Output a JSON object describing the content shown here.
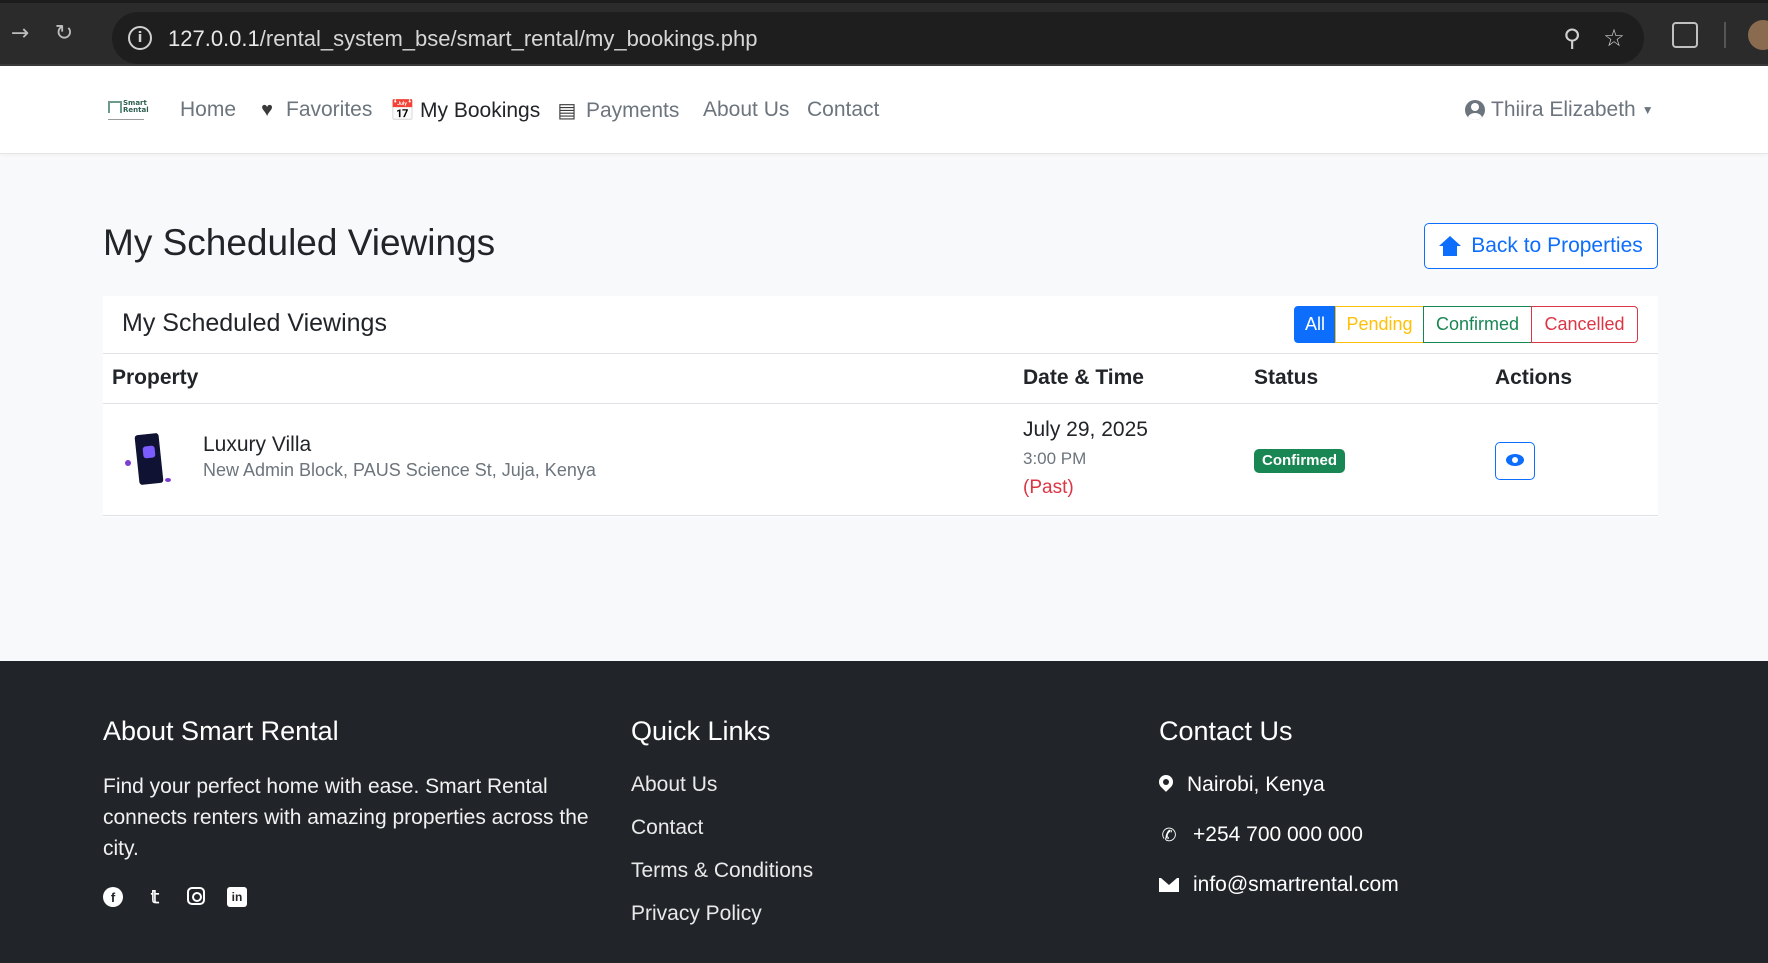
{
  "browser": {
    "url_host": "127.0.0.1",
    "url_path": "/rental_system_bse/smart_rental/my_bookings.php"
  },
  "navbar": {
    "logo_text": "Smart Rental",
    "links": [
      {
        "label": "Home",
        "icon": ""
      },
      {
        "label": "Favorites",
        "icon": "heart-icon"
      },
      {
        "label": "My Bookings",
        "icon": "calendar-icon",
        "active": true
      },
      {
        "label": "Payments",
        "icon": "credit-card-icon"
      },
      {
        "label": "About Us",
        "icon": ""
      },
      {
        "label": "Contact",
        "icon": ""
      }
    ],
    "user_name": "Thiira Elizabeth"
  },
  "page": {
    "title": "My Scheduled Viewings",
    "back_button": "Back to Properties"
  },
  "card": {
    "title": "My Scheduled Viewings",
    "filters": [
      "All",
      "Pending",
      "Confirmed",
      "Cancelled"
    ],
    "active_filter": "All",
    "columns": [
      "Property",
      "Date & Time",
      "Status",
      "Actions"
    ],
    "rows": [
      {
        "property_name": "Luxury Villa",
        "address": "New Admin Block, PAUS Science St, Juja, Kenya",
        "date": "July 29, 2025",
        "time": "3:00 PM",
        "note": "(Past)",
        "status": "Confirmed"
      }
    ]
  },
  "footer": {
    "about_title": "About Smart Rental",
    "about_text": "Find your perfect home with ease. Smart Rental connects renters with amazing properties across the city.",
    "quick_title": "Quick Links",
    "quick_links": [
      "About Us",
      "Contact",
      "Terms & Conditions",
      "Privacy Policy"
    ],
    "contact_title": "Contact Us",
    "location": "Nairobi, Kenya",
    "phone": "+254 700 000 000",
    "email": "info@smartrental.com"
  },
  "colors": {
    "primary": "#0d6efd",
    "success": "#198754",
    "warning": "#ffc107",
    "danger": "#dc3545",
    "footer_bg": "#212529"
  }
}
